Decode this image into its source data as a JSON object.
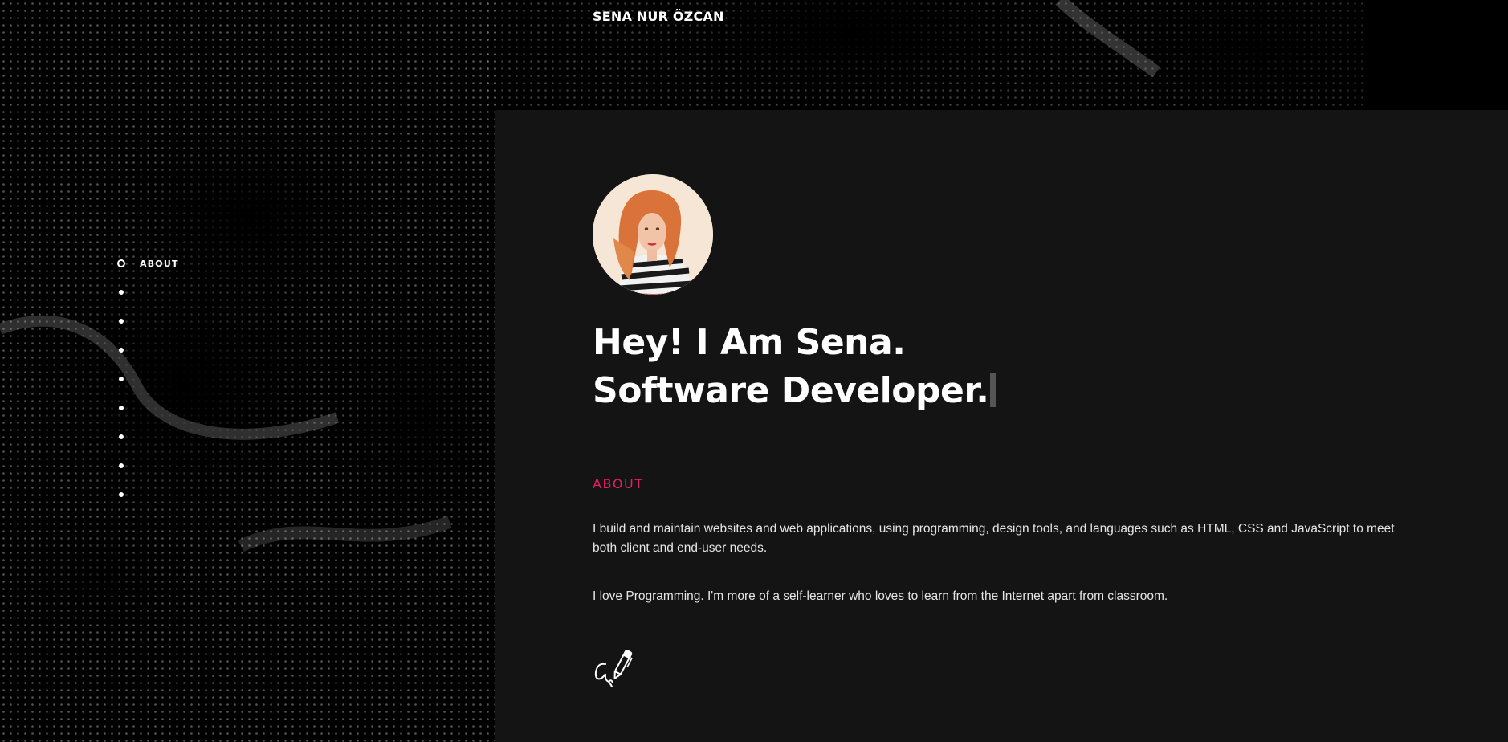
{
  "header": {
    "brand": "SENA NUR ÖZCAN"
  },
  "side_nav": {
    "items": [
      {
        "label": "ABOUT",
        "active": true
      },
      {
        "label": "",
        "active": false
      },
      {
        "label": "",
        "active": false
      },
      {
        "label": "",
        "active": false
      },
      {
        "label": "",
        "active": false
      },
      {
        "label": "",
        "active": false
      },
      {
        "label": "",
        "active": false
      },
      {
        "label": "",
        "active": false
      },
      {
        "label": "",
        "active": false
      }
    ]
  },
  "hero": {
    "line1": "Hey! I Am Sena.",
    "line2": "Software Developer."
  },
  "about": {
    "title": "ABOUT",
    "paragraph1": "I build and maintain websites and web applications, using programming, design tools, and languages such as HTML, CSS and JavaScript to meet both client and end-user needs.",
    "paragraph2": "I love Programming. I'm more of a self-learner who loves to learn from the Internet apart from classroom."
  },
  "icons": {
    "avatar": "profile-photo",
    "signature": "signature-pen-icon"
  },
  "colors": {
    "background": "#000000",
    "panel": "#141414",
    "accent": "#e91e63",
    "text": "#ffffff"
  }
}
